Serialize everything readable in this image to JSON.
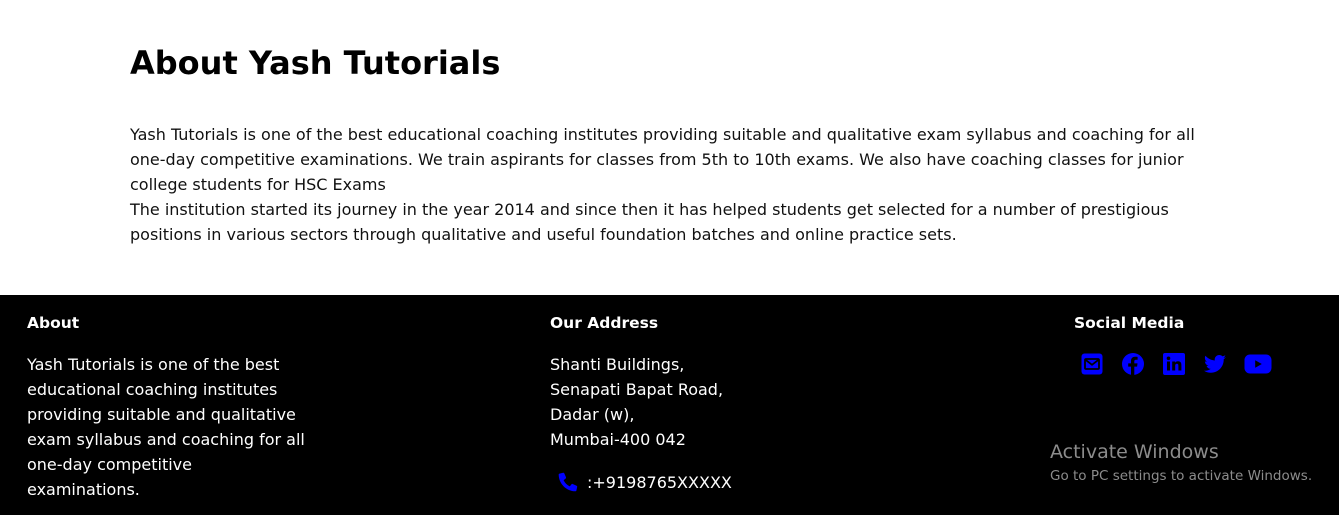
{
  "about": {
    "title": "About Yash Tutorials",
    "paragraph1": "Yash Tutorials is one of the best educational coaching institutes providing suitable and qualitative exam syllabus and coaching for all one-day competitive examinations. We train aspirants for classes from 5th to 10th exams. We also have coaching classes for junior college students for HSC Exams",
    "paragraph2": "The institution started its journey in the year 2014 and since then it has helped students get selected for a number of prestigious positions in various sectors through qualitative and useful foundation batches and online practice sets."
  },
  "footer": {
    "about": {
      "title": "About",
      "text": "Yash Tutorials is one of the best educational coaching institutes providing suitable and qualitative exam syllabus and coaching for all one-day competitive examinations."
    },
    "address": {
      "title": "Our Address",
      "lines": [
        "Shanti Buildings,",
        "Senapati Bapat Road,",
        "Dadar (w),",
        "Mumbai-400 042"
      ],
      "phone": ":+9198765XXXXX"
    },
    "social": {
      "title": "Social Media",
      "icons": [
        "email-icon",
        "facebook-icon",
        "linkedin-icon",
        "twitter-icon",
        "youtube-icon"
      ],
      "icon_color": "#0000ff"
    }
  },
  "watermark": {
    "title": "Activate Windows",
    "subtitle": "Go to PC settings to activate Windows."
  },
  "colors": {
    "footer_bg": "#000000",
    "icon_blue": "#0000ff"
  }
}
